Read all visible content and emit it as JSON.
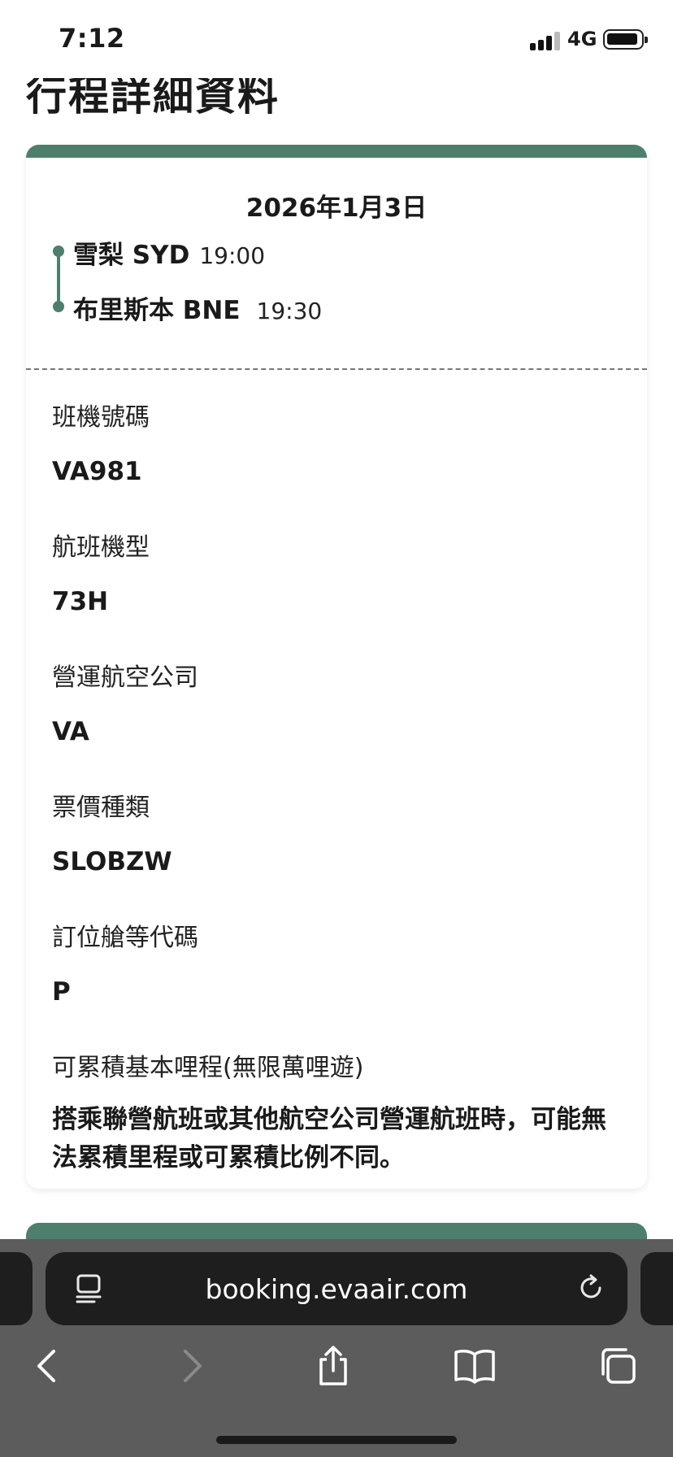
{
  "status_bar": {
    "time": "7:12",
    "network": "4G"
  },
  "page": {
    "title": "行程詳細資料"
  },
  "flight": {
    "date": "2026年1月3日",
    "departure": {
      "city": "雪梨 SYD",
      "time": "19:00"
    },
    "arrival": {
      "city": "布里斯本 BNE",
      "time": "19:30"
    },
    "details": [
      {
        "label": "班機號碼",
        "value": "VA981"
      },
      {
        "label": "航班機型",
        "value": "73H"
      },
      {
        "label": "營運航空公司",
        "value": "VA"
      },
      {
        "label": "票價種類",
        "value": "SLOBZW"
      },
      {
        "label": "訂位艙等代碼",
        "value": "P"
      }
    ],
    "mileage": {
      "label": "可累積基本哩程(無限萬哩遊)",
      "note": "搭乘聯營航班或其他航空公司營運航班時，可能無法累積里程或可累積比例不同。"
    }
  },
  "browser": {
    "url": "booking.evaair.com"
  },
  "colors": {
    "accent": "#4d7f6c",
    "toolbar": "#5c5c5c",
    "url_bar": "#1e1e1e"
  },
  "icons": [
    "reader-icon",
    "reload-icon",
    "back-icon",
    "forward-icon",
    "share-icon",
    "bookmarks-icon",
    "tabs-icon"
  ]
}
